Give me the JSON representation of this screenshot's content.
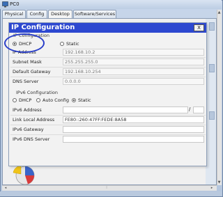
{
  "window": {
    "title": "PC0"
  },
  "tabs": [
    {
      "label": "Physical"
    },
    {
      "label": "Config"
    },
    {
      "label": "Desktop"
    },
    {
      "label": "Software/Services"
    }
  ],
  "dialog": {
    "title": "IP Configuration",
    "close_label": "X",
    "section_ipv4": "IP Configuration",
    "dhcp_label": "DHCP",
    "static_label": "Static",
    "ip_address_label": "IP Address",
    "ip_address_value": "192.168.10.2",
    "subnet_mask_label": "Subnet Mask",
    "subnet_mask_value": "255.255.255.0",
    "default_gateway_label": "Default Gateway",
    "default_gateway_value": "192.168.10.254",
    "dns_server_label": "DNS Server",
    "dns_server_value": "0.0.0.0",
    "section_ipv6": "IPv6 Configuration",
    "ipv6_dhcp_label": "DHCP",
    "ipv6_auto_label": "Auto Config",
    "ipv6_static_label": "Static",
    "ipv6_address_label": "IPv6 Address",
    "ipv6_address_value": "",
    "ipv6_prefix_sep": "/",
    "link_local_label": "Link Local Address",
    "link_local_value": "FE80::260:47FF:FEDE:8A58",
    "ipv6_gateway_label": "IPv6 Gateway",
    "ipv6_gateway_value": "",
    "ipv6_dns_label": "IPv6 DNS Server",
    "ipv6_dns_value": ""
  },
  "scrollbars": {
    "up": "▲",
    "down": "▼",
    "left": "◂",
    "right": "▸",
    "grip": "⦙"
  },
  "colors": {
    "dialog_header": "#2d48d0",
    "annotation_circle": "#2a3fc9"
  }
}
